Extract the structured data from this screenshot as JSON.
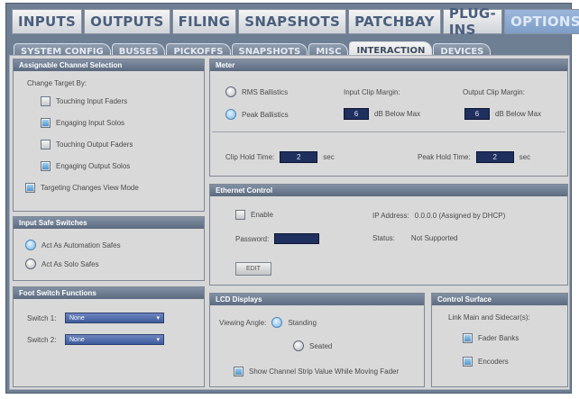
{
  "main_tabs": [
    {
      "label": "INPUTS",
      "active": false
    },
    {
      "label": "OUTPUTS",
      "active": false
    },
    {
      "label": "FILING",
      "active": false
    },
    {
      "label": "SNAPSHOTS",
      "active": false
    },
    {
      "label": "PATCHBAY",
      "active": false
    },
    {
      "label": "PLUG-INS",
      "active": false
    },
    {
      "label": "OPTIONS",
      "active": true
    }
  ],
  "sub_tabs": [
    {
      "label": "SYSTEM CONFIG",
      "active": false
    },
    {
      "label": "BUSSES",
      "active": false
    },
    {
      "label": "PICKOFFS",
      "active": false
    },
    {
      "label": "SNAPSHOTS",
      "active": false
    },
    {
      "label": "MISC",
      "active": false
    },
    {
      "label": "INTERACTION",
      "active": true
    },
    {
      "label": "DEVICES",
      "active": false
    }
  ],
  "assignable": {
    "title": "Assignable Channel Selection",
    "change_target_label": "Change Target By:",
    "options": [
      {
        "label": "Touching Input Faders",
        "checked": false
      },
      {
        "label": "Engaging Input Solos",
        "checked": true
      },
      {
        "label": "Touching Output Faders",
        "checked": false
      },
      {
        "label": "Engaging Output Solos",
        "checked": true
      }
    ],
    "targeting": {
      "label": "Targeting Changes View Mode",
      "checked": true
    }
  },
  "input_safe": {
    "title": "Input Safe Switches",
    "options": [
      {
        "label": "Act As Automation Safes",
        "selected": true
      },
      {
        "label": "Act As Solo Safes",
        "selected": false
      }
    ]
  },
  "foot_switch": {
    "title": "Foot Switch Functions",
    "switch1_label": "Switch 1:",
    "switch1_value": "None",
    "switch2_label": "Switch 2:",
    "switch2_value": "None"
  },
  "meter": {
    "title": "Meter",
    "rms_label": "RMS Ballistics",
    "peak_label": "Peak Ballistics",
    "ballistics_selected": "peak",
    "input_clip_margin_label": "Input Clip Margin:",
    "input_clip_value": "6",
    "input_clip_unit": "dB Below Max",
    "output_clip_margin_label": "Output Clip Margin:",
    "output_clip_value": "6",
    "output_clip_unit": "dB Below Max",
    "clip_hold_label": "Clip Hold Time:",
    "clip_hold_value": "2",
    "clip_hold_unit": "sec",
    "peak_hold_label": "Peak Hold Time:",
    "peak_hold_value": "2",
    "peak_hold_unit": "sec"
  },
  "ethernet": {
    "title": "Ethernet Control",
    "enable_label": "Enable",
    "enable_checked": false,
    "ip_label": "IP Address:",
    "ip_value": "0.0.0.0 (Assigned by DHCP)",
    "password_label": "Password:",
    "status_label": "Status:",
    "status_value": "Not Supported",
    "edit_label": "EDIT"
  },
  "lcd": {
    "title": "LCD Displays",
    "viewing_angle_label": "Viewing Angle:",
    "standing_label": "Standing",
    "seated_label": "Seated",
    "angle_selected": "standing",
    "show_value_label": "Show Channel Strip Value While Moving Fader",
    "show_value_checked": true
  },
  "control_surface": {
    "title": "Control Surface",
    "link_label": "Link Main and Sidecar(s):",
    "fader_banks_label": "Fader Banks",
    "fader_banks_checked": true,
    "encoders_label": "Encoders",
    "encoders_checked": true
  },
  "colors": {
    "accent": "#7e9ec8",
    "panel_header": "#5c6b80",
    "value_field": "#1f2f5e",
    "dropdown": "#3e5b9b"
  }
}
